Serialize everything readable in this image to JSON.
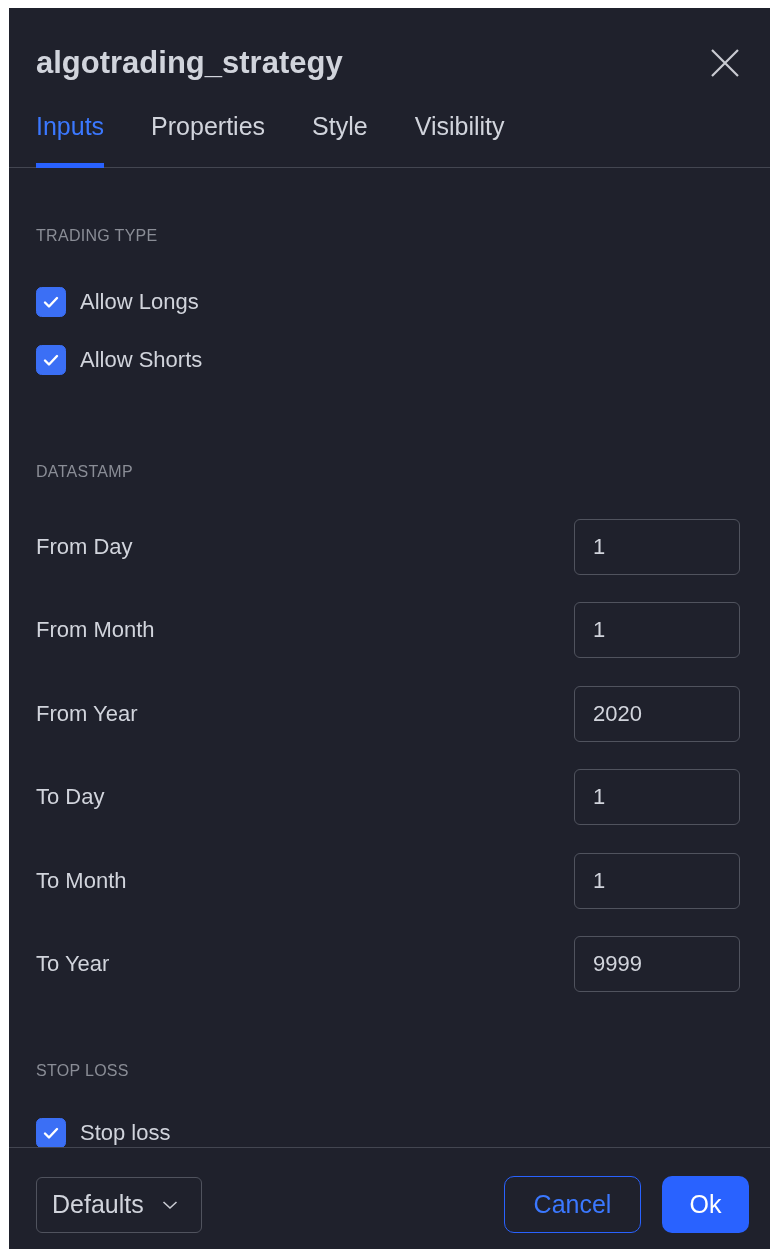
{
  "dialog": {
    "title": "algotrading_strategy"
  },
  "tabs": [
    {
      "label": "Inputs",
      "selected": true
    },
    {
      "label": "Properties",
      "selected": false
    },
    {
      "label": "Style",
      "selected": false
    },
    {
      "label": "Visibility",
      "selected": false
    }
  ],
  "sections": [
    {
      "heading": "TRADING TYPE",
      "items": [
        {
          "kind": "checkbox",
          "label": "Allow Longs",
          "checked": true
        },
        {
          "kind": "checkbox",
          "label": "Allow Shorts",
          "checked": true
        }
      ]
    },
    {
      "heading": "DATASTAMP",
      "items": [
        {
          "kind": "field",
          "label": "From Day",
          "value": "1"
        },
        {
          "kind": "field",
          "label": "From Month",
          "value": "1"
        },
        {
          "kind": "field",
          "label": "From Year",
          "value": "2020"
        },
        {
          "kind": "field",
          "label": "To Day",
          "value": "1"
        },
        {
          "kind": "field",
          "label": "To Month",
          "value": "1"
        },
        {
          "kind": "field",
          "label": "To Year",
          "value": "9999"
        }
      ]
    },
    {
      "heading": "STOP LOSS",
      "items": [
        {
          "kind": "checkbox",
          "label": "Stop loss",
          "checked": true
        }
      ]
    }
  ],
  "footer": {
    "defaults": "Defaults",
    "cancel": "Cancel",
    "ok": "Ok"
  }
}
